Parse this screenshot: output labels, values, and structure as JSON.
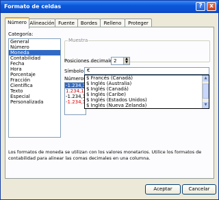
{
  "window": {
    "title": "Formato de celdas",
    "help_glyph": "?",
    "close_glyph": "x"
  },
  "tabs": [
    "Número",
    "Alineación",
    "Fuente",
    "Bordes",
    "Relleno",
    "Proteger"
  ],
  "category": {
    "label": "Categoría:",
    "items": [
      "General",
      "Número",
      "Moneda",
      "Contabilidad",
      "Fecha",
      "Hora",
      "Porcentaje",
      "Fracción",
      "Científica",
      "Texto",
      "Especial",
      "Personalizada"
    ],
    "selected": "Moneda"
  },
  "sample": {
    "label": "Muestra"
  },
  "decimals": {
    "label": "Posiciones decimales:",
    "value": "2"
  },
  "symbol": {
    "label": "Símbolo:",
    "value": "€",
    "options": [
      "$ Francés (Canadá)",
      "$ Inglés (Australia)",
      "$ Inglés (Canadá)",
      "$ Inglés (Caribe)",
      "$ Inglés (Estados Unidos)",
      "$ Inglés (Nueva Zelanda)"
    ]
  },
  "negative": {
    "label": "Números n",
    "items": [
      {
        "text": "-1.234,10",
        "color": "#ffffff",
        "bg": "#316ac5"
      },
      {
        "text": "1.234,10",
        "color": "#e00000",
        "bg": "#ffffff"
      },
      {
        "text": "-1.234,10",
        "color": "#000000",
        "bg": "#ffffff"
      },
      {
        "text": "-1.234,10",
        "color": "#e00000",
        "bg": "#ffffff"
      }
    ]
  },
  "description": "Los formatos de moneda se utilizan con los valores monetarios. Utilice los formatos de contabilidad para alinear las comas decimales en una columna.",
  "buttons": {
    "ok": "Aceptar",
    "cancel": "Cancelar"
  }
}
